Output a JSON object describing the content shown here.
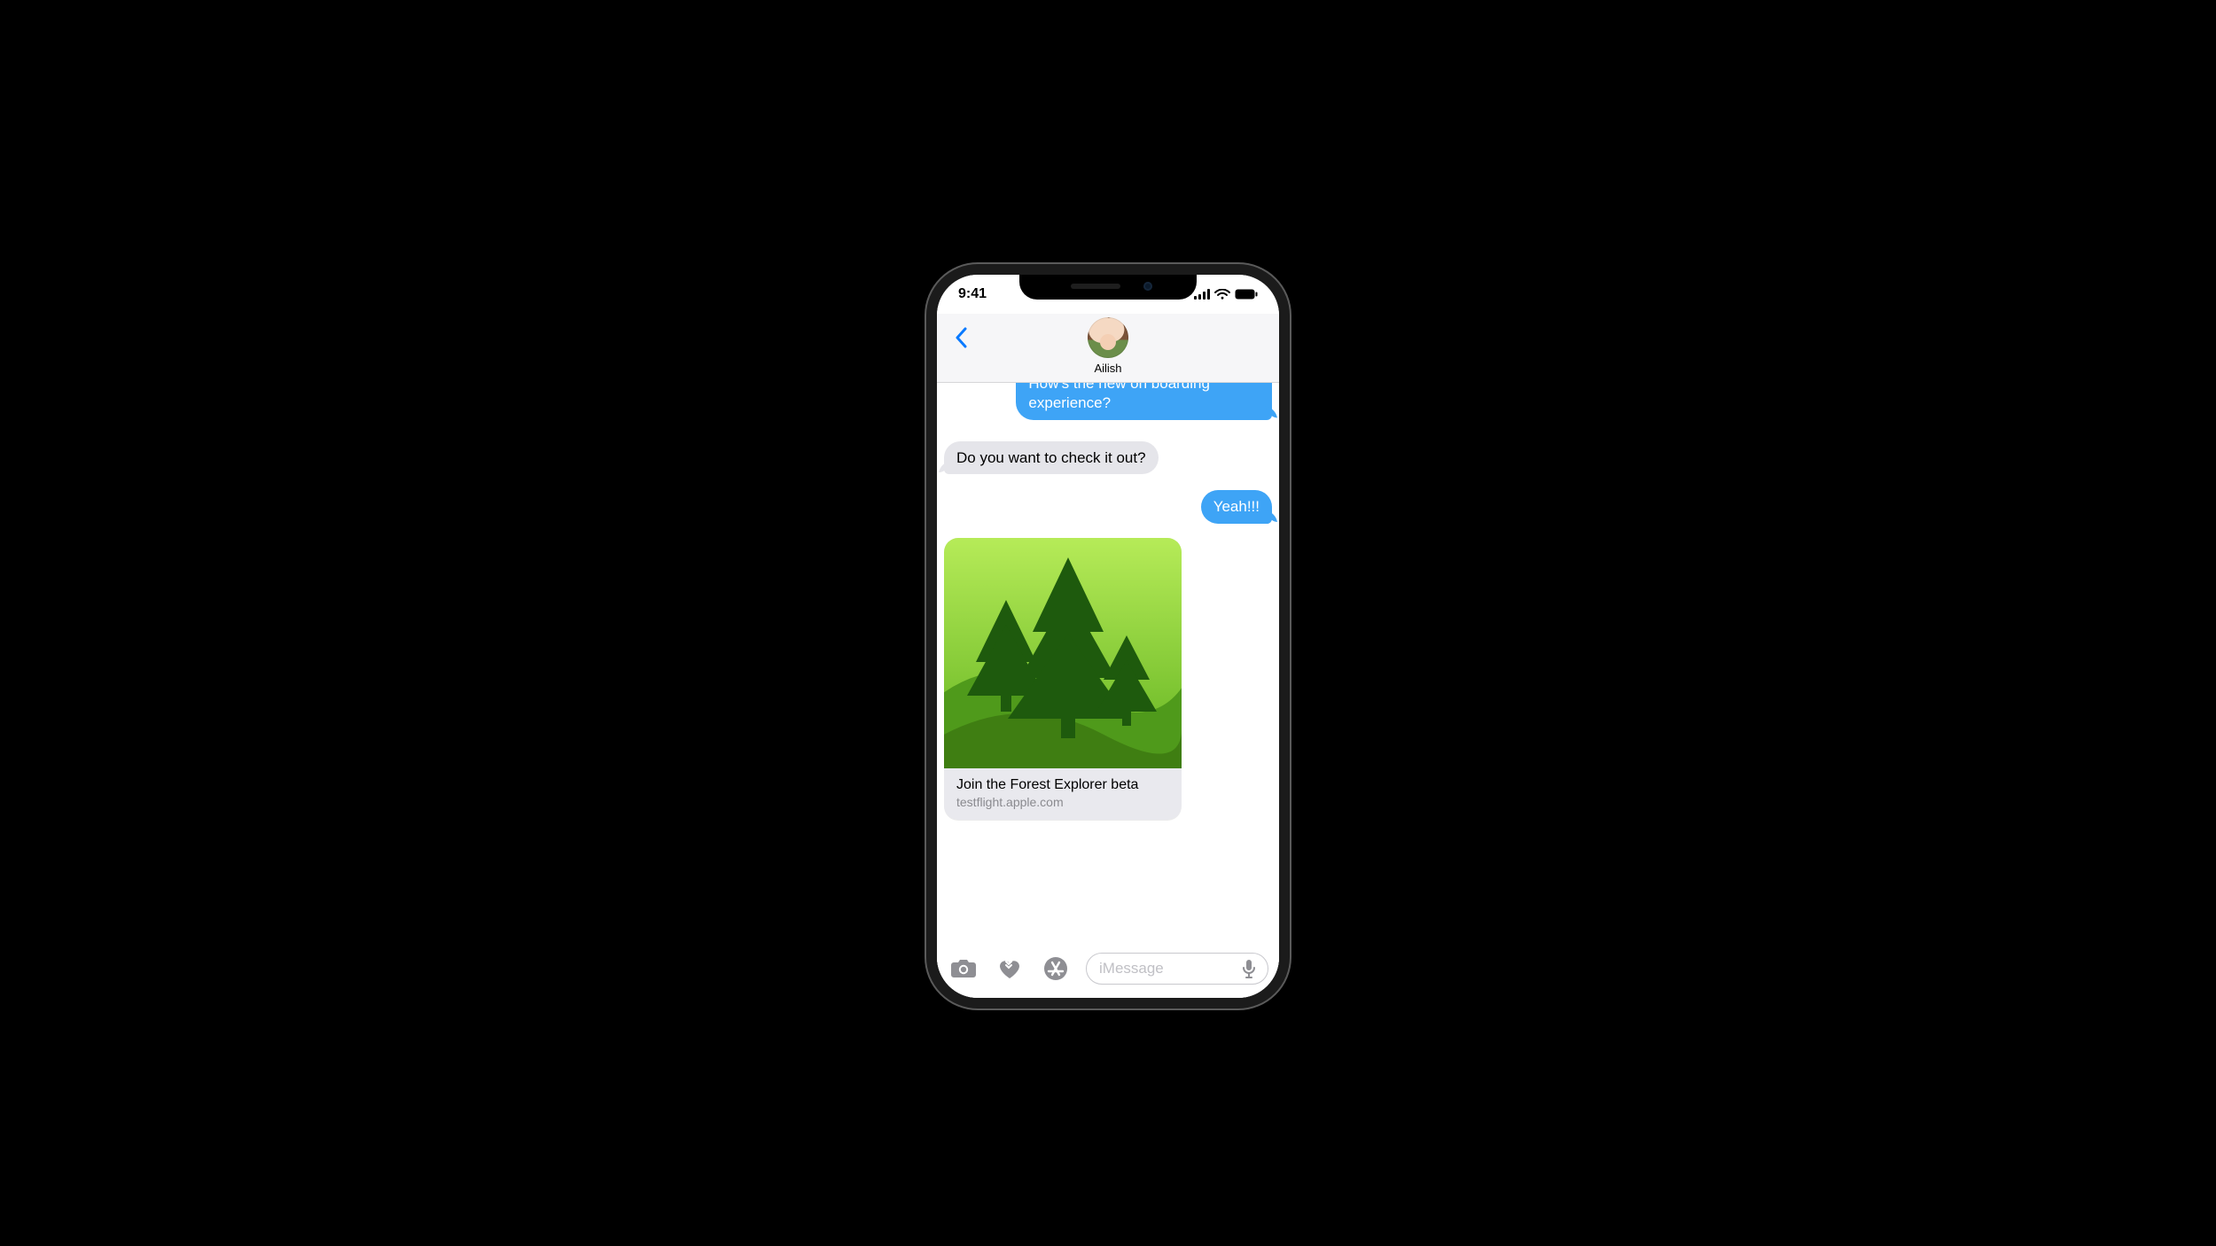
{
  "statusbar": {
    "time": "9:41"
  },
  "header": {
    "contact_name": "Ailish",
    "back_icon": "chevron-left-icon"
  },
  "messages": [
    {
      "side": "sent",
      "text": "How's the new on boarding experience?",
      "clipped": true
    },
    {
      "side": "recv",
      "text": "Do you want to check it out?"
    },
    {
      "side": "sent",
      "text": "Yeah!!!"
    }
  ],
  "link_card": {
    "title": "Join the Forest Explorer beta",
    "url": "testflight.apple.com",
    "icon": "forest-trees-icon"
  },
  "compose": {
    "placeholder": "iMessage",
    "icons": {
      "camera": "camera-icon",
      "digital_touch": "digital-touch-icon",
      "appstore": "appstore-icon",
      "mic": "mic-icon"
    }
  }
}
